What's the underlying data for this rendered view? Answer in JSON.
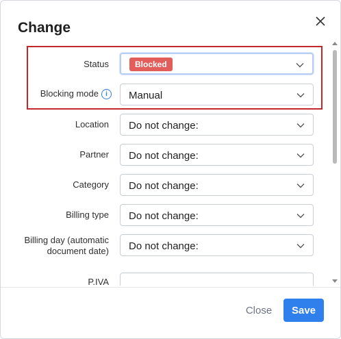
{
  "dialog": {
    "title": "Change"
  },
  "fields": [
    {
      "label": "Status",
      "type": "select",
      "badge": "Blocked",
      "badge_color": "#e35d5b"
    },
    {
      "label": "Blocking mode",
      "type": "select",
      "value": "Manual",
      "info_icon": "info-icon"
    },
    {
      "label": "Location",
      "type": "select",
      "value": "Do not change:"
    },
    {
      "label": "Partner",
      "type": "select",
      "value": "Do not change:"
    },
    {
      "label": "Category",
      "type": "select",
      "value": "Do not change:"
    },
    {
      "label": "Billing type",
      "type": "select",
      "value": "Do not change:"
    },
    {
      "label_line1": "Billing day (automatic",
      "label_line2": "document date)",
      "type": "select",
      "value": "Do not change:"
    },
    {
      "label": "P.IVA",
      "type": "input",
      "value": ""
    }
  ],
  "footer": {
    "close_label": "Close",
    "save_label": "Save"
  },
  "colors": {
    "primary": "#2f80ed",
    "highlight_border": "#c3272a",
    "info": "#2f7de1"
  },
  "icons": {
    "close": "close-icon",
    "dropdown": "chevron-down-icon",
    "info": "info-icon"
  }
}
